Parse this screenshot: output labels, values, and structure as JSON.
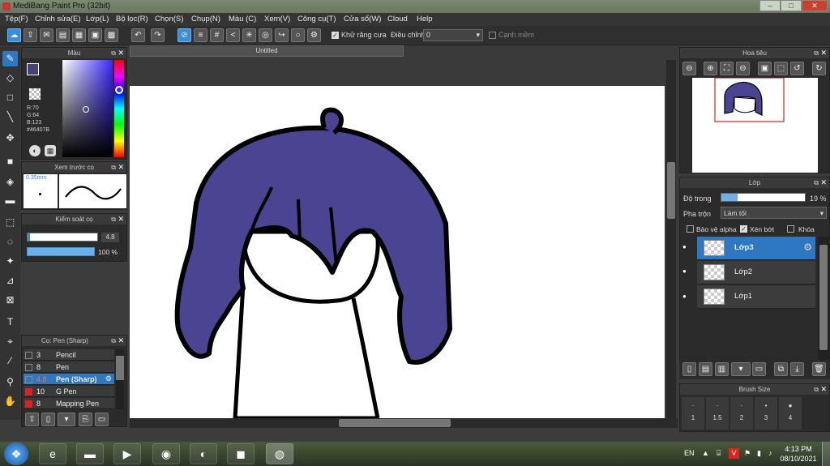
{
  "window": {
    "title": "MediBang Paint Pro (32bit)",
    "min": "–",
    "max": "□",
    "close": "✕"
  },
  "menu": [
    "Tệp(F)",
    "Chỉnh sửa(E)",
    "Lớp(L)",
    "Bộ lọc(R)",
    "Chọn(S)",
    "Chụp(N)",
    "Màu (C)",
    "Xem(V)",
    "Công cụ(T)",
    "Cửa sổ(W)",
    "Cloud",
    "Help"
  ],
  "toolbar": {
    "antialias_label": "Khử răng cưa",
    "adjust_label": "Điều chỉnh",
    "adjust_value": "0",
    "smooth_label": "Cạnh mềm"
  },
  "color_panel": {
    "title": "Màu",
    "r": "R:70",
    "g": "G:64",
    "b": "B:123",
    "hex": "#46407B",
    "fg_color": "#46407B"
  },
  "brush_preview": {
    "title": "Xem trước cọ",
    "size": "0.35mm"
  },
  "brush_control": {
    "title": "Kiểm soát cọ",
    "size_value": "4.8",
    "opacity_value": "100 %"
  },
  "brush_list": {
    "title": "Cọ: Pen (Sharp)",
    "items": [
      {
        "num": "3",
        "label": "Pencil",
        "color": "#333"
      },
      {
        "num": "8",
        "label": "Pen",
        "color": "#333"
      },
      {
        "num": "4.8",
        "label": "Pen (Sharp)",
        "color": "#333"
      },
      {
        "num": "10",
        "label": "G Pen",
        "color": "#e02020"
      },
      {
        "num": "8",
        "label": "Mapping Pen",
        "color": "#e02020"
      }
    ]
  },
  "document": {
    "tab": "Untitled"
  },
  "navigator": {
    "title": "Hoa tiêu"
  },
  "layers": {
    "title": "Lớp",
    "opacity_label": "Độ trong",
    "opacity_value": "19 %",
    "opacity_fraction": 0.19,
    "blend_label": "Pha trộn",
    "blend_value": "Làm tối",
    "protect_alpha": "Bảo vệ alpha",
    "clipping": "Xén bớt",
    "lock": "Khóa",
    "items": [
      {
        "name": "Lớp3"
      },
      {
        "name": "Lớp2"
      },
      {
        "name": "Lớp1"
      }
    ]
  },
  "brush_size": {
    "title": "Brush Size",
    "sizes": [
      "1",
      "1.5",
      "2",
      "3",
      "4"
    ]
  },
  "taskbar": {
    "lang": "EN",
    "time": "4:13 PM",
    "date": "08/10/2021"
  }
}
